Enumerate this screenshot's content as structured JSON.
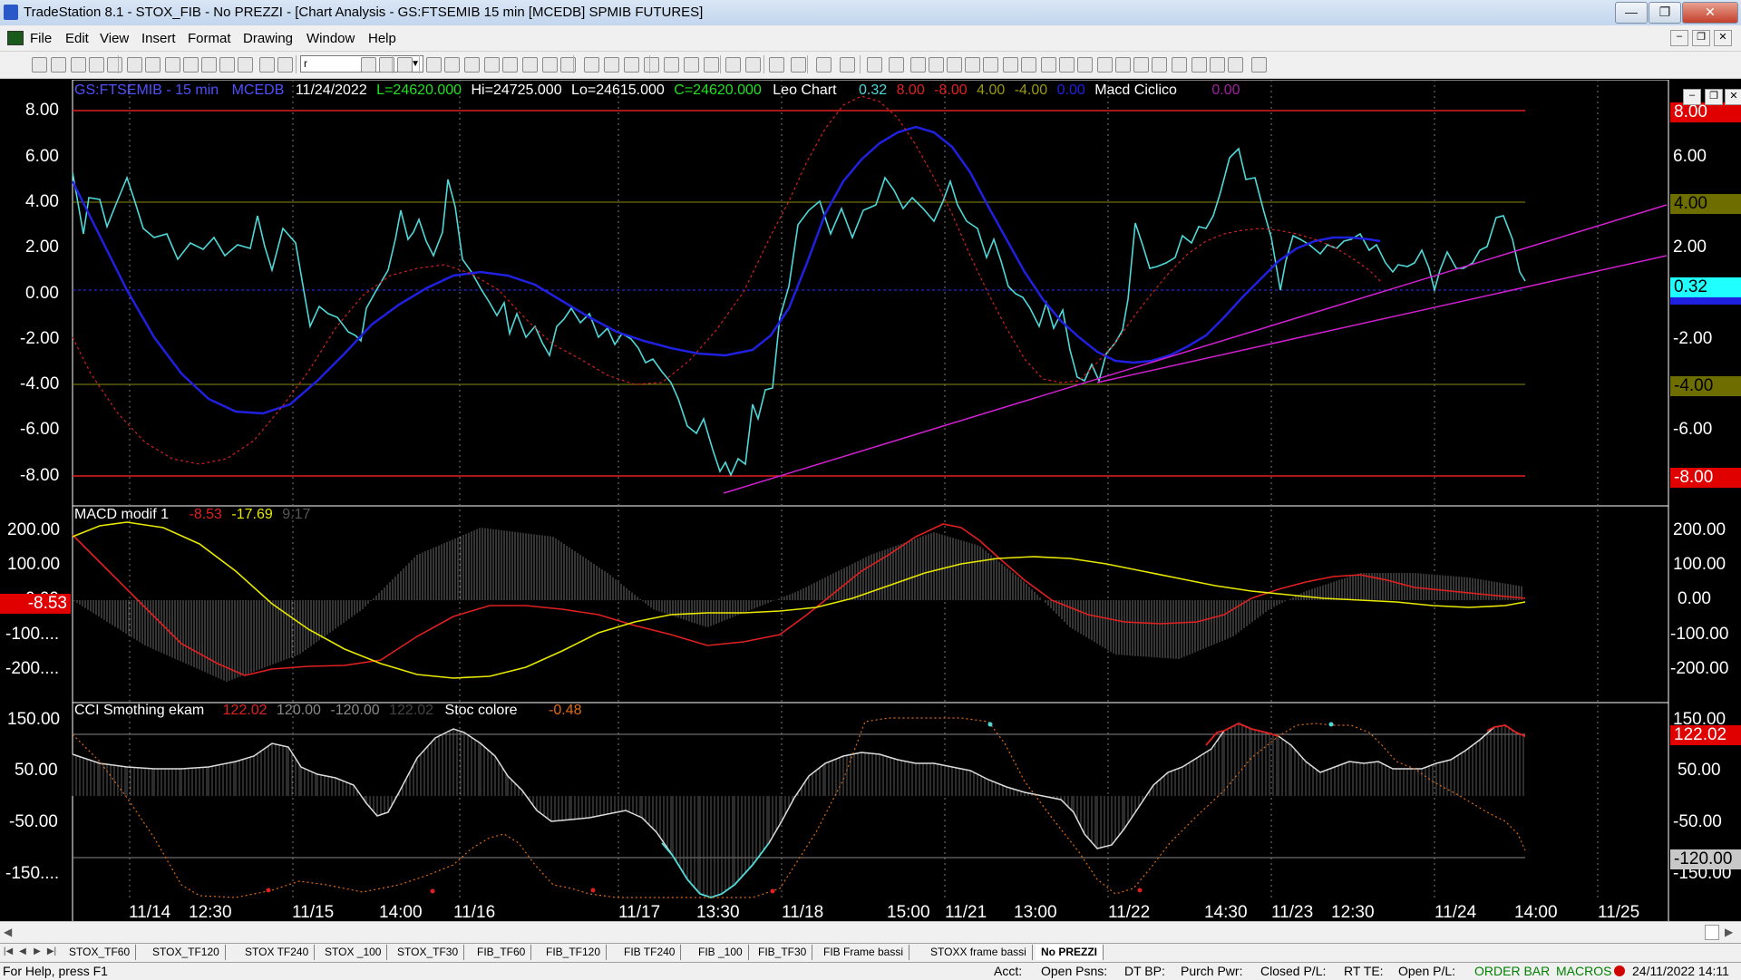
{
  "window": {
    "title": "TradeStation 8.1 - STOX_FIB - No PREZZI - [Chart Analysis - GS:FTSEMIB  15 min  [MCEDB] SPMIB FUTURES]"
  },
  "menu": [
    "File",
    "Edit",
    "View",
    "Insert",
    "Format",
    "Drawing",
    "Window",
    "Help"
  ],
  "toolbar": {
    "symbol_combo_value": "r"
  },
  "price_panel": {
    "header": {
      "symbol": "GS:FTSEMIB - 15 min",
      "feed": "MCEDB",
      "date": "11/24/2022",
      "last": "L=24620.000",
      "high": "Hi=24725.000",
      "low": "Lo=24615.000",
      "close": "C=24620.000",
      "indicator": "Leo Chart",
      "v1": "0.32",
      "v2": "8.00",
      "v3": "-8.00",
      "v4": "4.00",
      "v5": "-4.00",
      "v6": "0.00",
      "indicator2": "Macd Ciclico",
      "v7": "0.00"
    },
    "axis_left": [
      "8.00",
      "6.00",
      "4.00",
      "2.00",
      "0.00",
      "-2.00",
      "-4.00",
      "-6.00",
      "-8.00"
    ],
    "axis_right": [
      "6.00",
      "2.00",
      "-2.00",
      "-6.00"
    ],
    "tags": {
      "t8": "8.00",
      "t4": "4.00",
      "t032": "0.32",
      "tm4": "-4.00",
      "tm8": "-8.00"
    }
  },
  "macd_panel": {
    "header": {
      "name": "MACD modif 1",
      "v1": "-8.53",
      "v2": "-17.69",
      "v3": "9.17"
    },
    "axis_left": [
      "200.00",
      "100.00",
      "0.00",
      "-100....",
      "-200...."
    ],
    "axis_right": [
      "200.00",
      "100.00",
      "0.00",
      "-100.00",
      "-200.00"
    ],
    "tag_left": "-8.53"
  },
  "cci_panel": {
    "header": {
      "name": "CCI Smothing ekam",
      "v1": "122.02",
      "v2": "120.00",
      "v3": "-120.00",
      "v4": "122.02",
      "name2": "Stoc colore",
      "v5": "-0.48"
    },
    "axis_left": [
      "150.00",
      "50.00",
      "-50.00",
      "-150...."
    ],
    "axis_right": [
      "150.00",
      "50.00",
      "-50.00",
      "-150.00"
    ],
    "tags": {
      "t122": "122.02",
      "tm120": "-120.00"
    }
  },
  "date_axis": [
    "11/14",
    "12:30",
    "11/15",
    "14:00",
    "11/16",
    "11/17",
    "13:30",
    "11/18",
    "15:00",
    "11/21",
    "13:00",
    "11/22",
    "14:30",
    "11/23",
    "12:30",
    "11/24",
    "14:00",
    "11/25"
  ],
  "sheet_tabs": [
    "STOX_TF60",
    "STOX_TF120",
    "STOX TF240",
    "STOX _100",
    "STOX_TF30",
    "FIB_TF60",
    "FIB_TF120",
    "FIB TF240",
    "FIB _100",
    "FIB_TF30",
    "FIB Frame bassi",
    "STOXX frame bassi",
    "No PREZZI"
  ],
  "status": {
    "help": "For Help, press F1",
    "acct": "Acct:",
    "open_psns": "Open Psns:",
    "dt_bp": "DT BP:",
    "purch_pwr": "Purch Pwr:",
    "closed_pl": "Closed P/L:",
    "rt_te": "RT TE:",
    "open_pl": "Open P/L:",
    "order_bar": "ORDER BAR",
    "macros": "MACROS",
    "datetime": "24/11/2022 14:11"
  },
  "colors": {
    "cyan": "#4fd8d8",
    "blue": "#2020e0",
    "red": "#e02020",
    "yellow": "#e8e800",
    "magenta": "#d020d0",
    "olive": "#9a9a10",
    "orange": "#e06a10"
  }
}
